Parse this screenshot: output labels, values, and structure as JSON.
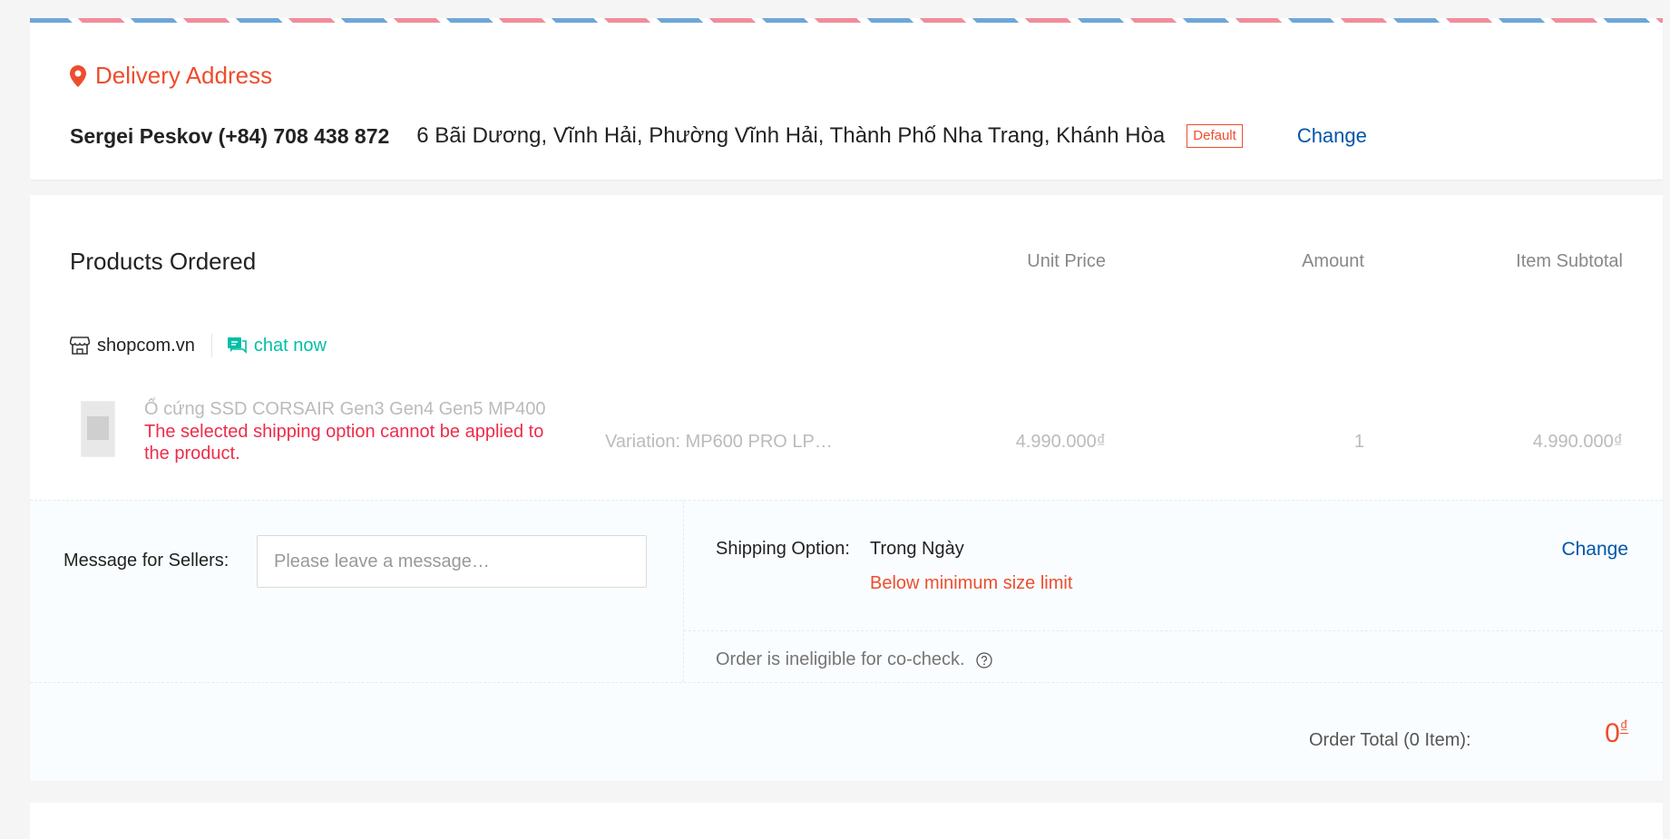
{
  "address": {
    "title": "Delivery Address",
    "name_phone": "Sergei Peskov (+84) 708 438 872",
    "address_line": "6 Bãi Dương, Vĩnh Hải, Phường Vĩnh Hải, Thành Phố Nha Trang, Khánh Hòa",
    "default_badge": "Default",
    "change_label": "Change",
    "pin_icon": "location-pin-icon",
    "accent_color": "#ee4d2d"
  },
  "products": {
    "title": "Products Ordered",
    "columns": {
      "unit_price": "Unit Price",
      "amount": "Amount",
      "item_subtotal": "Item Subtotal"
    },
    "shop": {
      "name": "shopcom.vn",
      "chat_label": "chat now",
      "shop_icon": "store-icon",
      "chat_icon": "chat-icon"
    },
    "item": {
      "name": "Ổ cứng SSD CORSAIR Gen3 Gen4 Gen5 MP400",
      "error": "The selected shipping option cannot be applied to the product.",
      "variation": "Variation: MP600 PRO LP…",
      "unit_price": "4.990.000₫",
      "amount": "1",
      "subtotal": "4.990.000₫"
    }
  },
  "message": {
    "label": "Message for Sellers:",
    "placeholder": "Please leave a message…"
  },
  "shipping": {
    "label": "Shipping Option:",
    "value": "Trong Ngày",
    "warning": "Below minimum size limit",
    "change_label": "Change",
    "cocheck_text": "Order is ineligible for co-check.",
    "help_icon": "question-circle-icon"
  },
  "total": {
    "label": "Order Total (0 Item):",
    "value": "0",
    "currency": "₫"
  }
}
